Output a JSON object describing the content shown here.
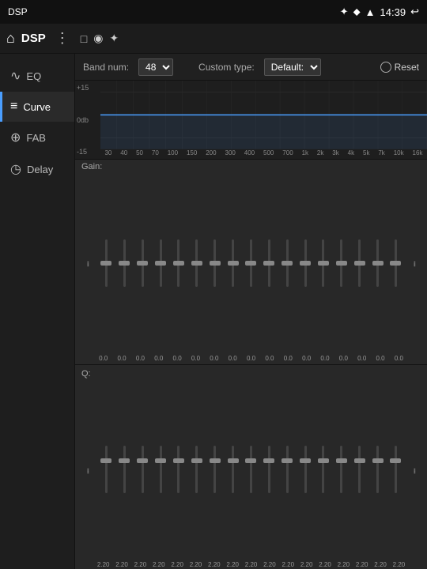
{
  "statusBar": {
    "appName": "DSP",
    "bluetooth": "✦",
    "location": "⬥",
    "wifi": "▲",
    "time": "14:39",
    "back": "↩"
  },
  "header": {
    "homeIcon": "⌂",
    "title": "DSP",
    "menuIcon": "⋮",
    "icons": [
      "□",
      "◉",
      "✦"
    ]
  },
  "sidebar": {
    "items": [
      {
        "id": "eq",
        "label": "EQ",
        "icon": "∿"
      },
      {
        "id": "curve",
        "label": "Curve",
        "icon": "≡",
        "active": true
      },
      {
        "id": "fab",
        "label": "FAB",
        "icon": "⊕"
      },
      {
        "id": "delay",
        "label": "Delay",
        "icon": "◷"
      }
    ]
  },
  "controls": {
    "bandNumLabel": "Band num:",
    "bandNum": "48",
    "customTypeLabel": "Custom type:",
    "customType": "Default:",
    "resetLabel": "Reset"
  },
  "eqGraph": {
    "yLabels": [
      "+15",
      "0db",
      "-15"
    ],
    "freqLabels": [
      "30",
      "40",
      "50",
      "70",
      "100",
      "150",
      "200",
      "300",
      "400",
      "500",
      "700",
      "1k",
      "2k",
      "3k",
      "4k",
      "5k",
      "7k",
      "10k",
      "16k"
    ]
  },
  "gainSection": {
    "label": "Gain:",
    "values": [
      "0.0",
      "0.0",
      "0.0",
      "0.0",
      "0.0",
      "0.0",
      "0.0",
      "0.0",
      "0.0",
      "0.0",
      "0.0",
      "0.0",
      "0.0",
      "0.0",
      "0.0",
      "0.0",
      "0.0"
    ]
  },
  "qSection": {
    "label": "Q:",
    "values": [
      "2.20",
      "2.20",
      "2.20",
      "2.20",
      "2.20",
      "2.20",
      "2.20",
      "2.20",
      "2.20",
      "2.20",
      "2.20",
      "2.20",
      "2.20",
      "2.20",
      "2.20",
      "2.20",
      "2.20"
    ]
  },
  "thumbPositions": {
    "gain": [
      50,
      50,
      50,
      50,
      50,
      50,
      50,
      50,
      50,
      50,
      50,
      50,
      50,
      50,
      50,
      50,
      50
    ],
    "q": [
      30,
      30,
      30,
      30,
      30,
      30,
      30,
      30,
      30,
      30,
      30,
      30,
      30,
      30,
      30,
      30,
      30
    ]
  }
}
